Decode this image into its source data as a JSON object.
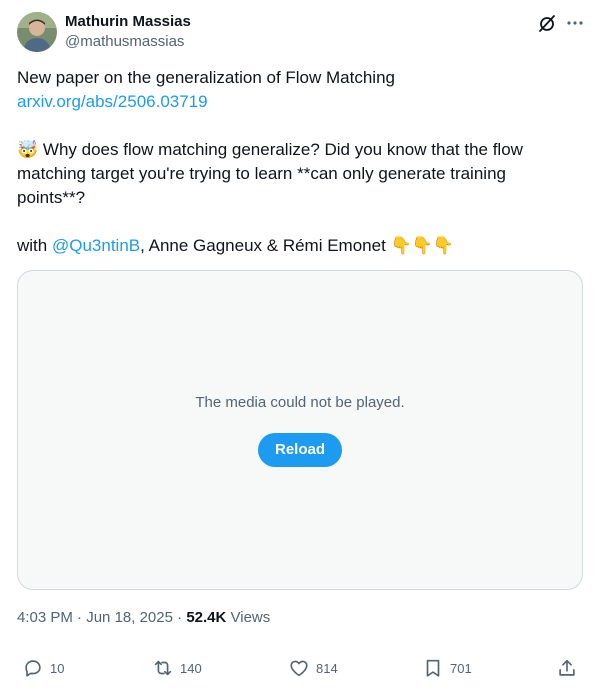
{
  "author": {
    "name": "Mathurin Massias",
    "handle": "@mathusmassias"
  },
  "header_icons": [
    "grok-icon",
    "more-icon"
  ],
  "tweet": {
    "line1": "New paper on the generalization of Flow Matching",
    "link": "arxiv.org/abs/2506.03719",
    "emoji": "🤯",
    "question": "Why does flow matching generalize? Did you know that the flow matching target you're trying to learn **can only generate training points**?",
    "with_prefix": "with",
    "mention": "@Qu3ntinB",
    "coauthors": ", Anne Gagneux & Rémi Emonet",
    "pointing_emojis": "👇👇👇"
  },
  "media": {
    "message": "The media could not be played.",
    "reload_label": "Reload"
  },
  "meta": {
    "time": "4:03 PM",
    "separator1": "·",
    "date": "Jun 18, 2025",
    "separator2": "·",
    "views_count": "52.4K",
    "views_label": "Views"
  },
  "actions": {
    "replies": "10",
    "reposts": "140",
    "likes": "814",
    "bookmarks": "701"
  },
  "colors": {
    "link": "#1d9bf0",
    "secondary_text": "#536471",
    "primary_text": "#0f1419",
    "media_bg": "#f7f9f9"
  }
}
